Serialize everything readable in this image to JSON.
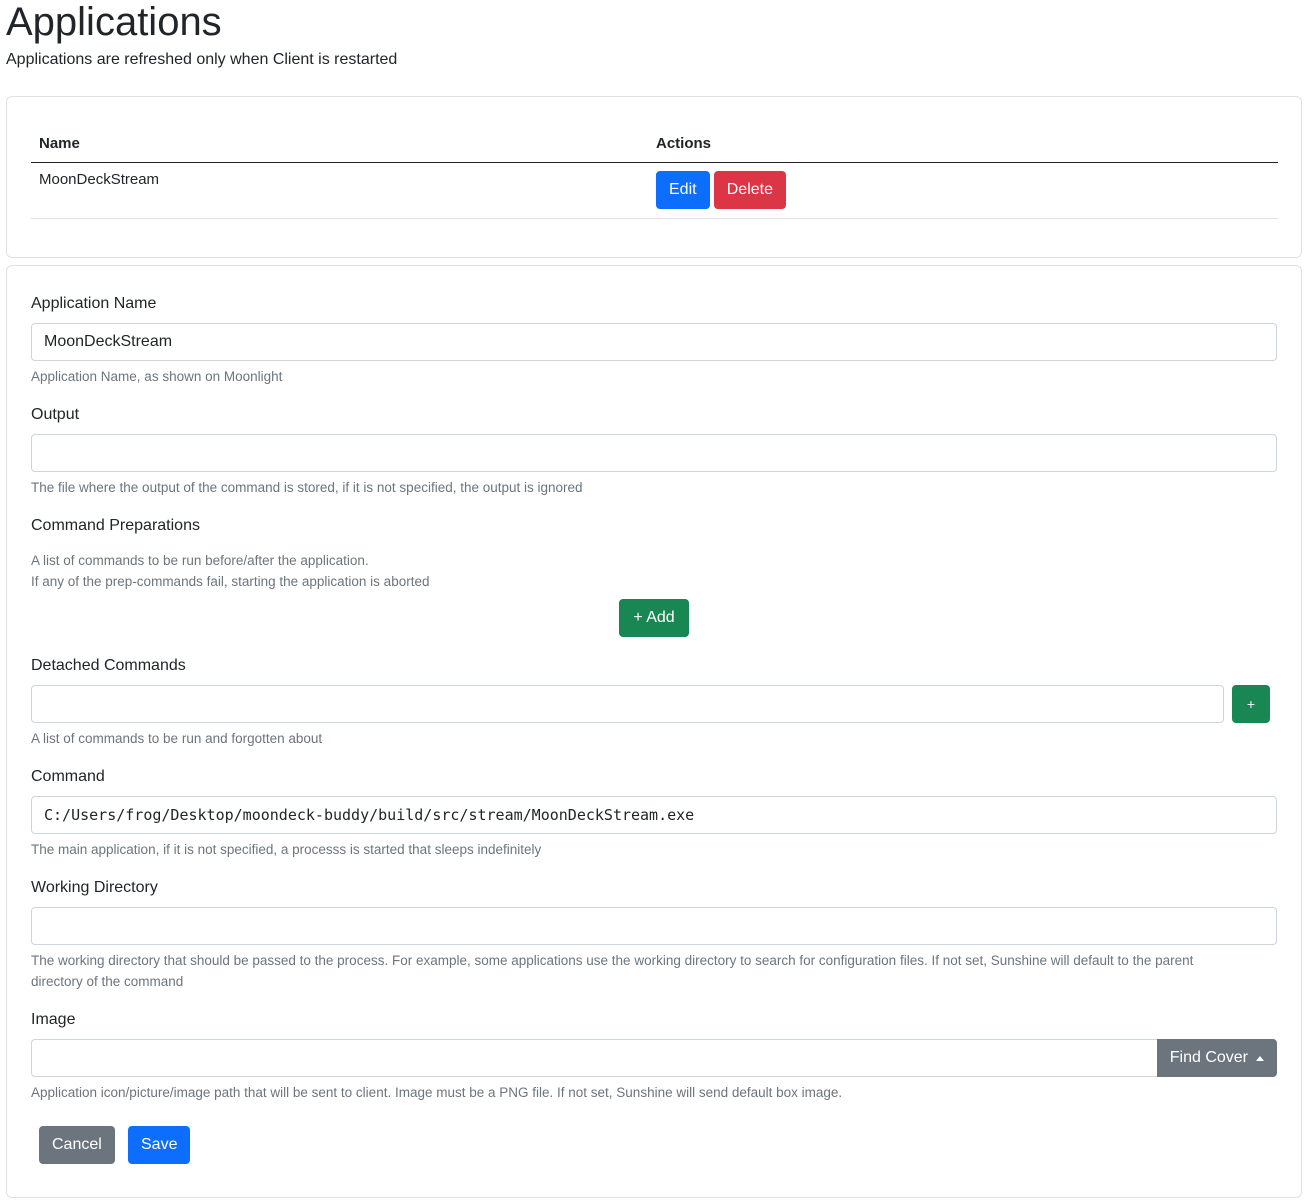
{
  "header": {
    "title": "Applications",
    "subtitle": "Applications are refreshed only when Client is restarted"
  },
  "apps_table": {
    "columns": [
      "Name",
      "Actions"
    ],
    "rows": [
      {
        "name": "MoonDeckStream",
        "edit_label": "Edit",
        "delete_label": "Delete"
      }
    ]
  },
  "form": {
    "app_name": {
      "label": "Application Name",
      "value": "MoonDeckStream",
      "help": "Application Name, as shown on Moonlight"
    },
    "output": {
      "label": "Output",
      "value": "",
      "help": "The file where the output of the command is stored, if it is not specified, the output is ignored"
    },
    "prep": {
      "label": "Command Preparations",
      "help_line1": "A list of commands to be run before/after the application.",
      "help_line2": "If any of the prep-commands fail, starting the application is aborted",
      "add_label": "+ Add"
    },
    "detached": {
      "label": "Detached Commands",
      "value": "",
      "add_label": "+",
      "help": "A list of commands to be run and forgotten about"
    },
    "command": {
      "label": "Command",
      "value": "C:/Users/frog/Desktop/moondeck-buddy/build/src/stream/MoonDeckStream.exe",
      "help": "The main application, if it is not specified, a processs is started that sleeps indefinitely"
    },
    "working_dir": {
      "label": "Working Directory",
      "value": "",
      "help": "The working directory that should be passed to the process. For example, some applications use the working directory to search for configuration files. If not set, Sunshine will default to the parent directory of the command"
    },
    "image": {
      "label": "Image",
      "value": "",
      "find_cover_label": "Find Cover",
      "help": "Application icon/picture/image path that will be sent to client. Image must be a PNG file. If not set, Sunshine will send default box image."
    },
    "cancel_label": "Cancel",
    "save_label": "Save"
  },
  "colors": {
    "primary": "#0d6efd",
    "danger": "#dc3545",
    "success": "#198754",
    "secondary": "#6c757d"
  }
}
